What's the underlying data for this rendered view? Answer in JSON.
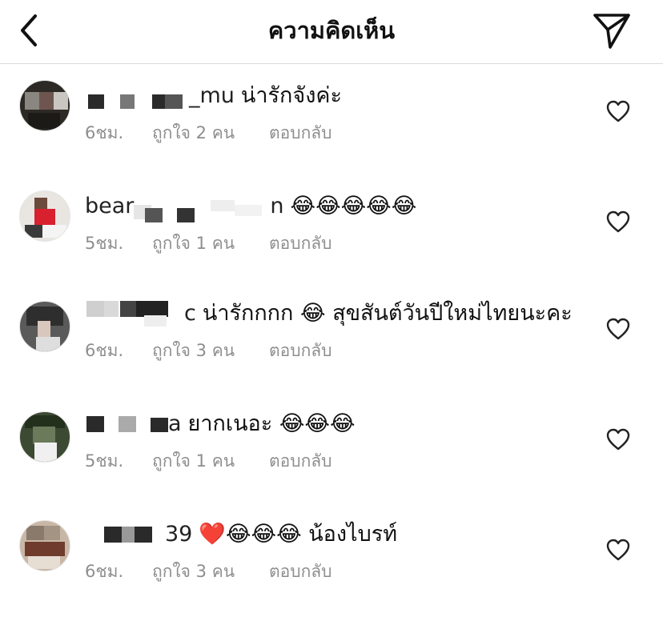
{
  "header": {
    "title": "ความคิดเห็น",
    "back_icon": "chevron-left-icon",
    "share_icon": "paper-plane-icon"
  },
  "comments": [
    {
      "username_visible": "_mu",
      "text": "น่ารักจังค่ะ",
      "time": "6ชม.",
      "likes": "ถูกใจ 2 คน",
      "reply": "ตอบกลับ"
    },
    {
      "username_visible": "bear",
      "username_visible_end": "n",
      "text": "😂😂😂😂😂",
      "time": "5ชม.",
      "likes": "ถูกใจ 1 คน",
      "reply": "ตอบกลับ"
    },
    {
      "username_visible": "c",
      "text": "น่ารักกกก 😂 สุขสันต์วันปีใหม่ไทยนะคะ",
      "time": "6ชม.",
      "likes": "ถูกใจ 3 คน",
      "reply": "ตอบกลับ"
    },
    {
      "username_visible": "a",
      "text": "ยากเนอะ 😂😂😂",
      "time": "5ชม.",
      "likes": "ถูกใจ 1 คน",
      "reply": "ตอบกลับ"
    },
    {
      "username_visible": "39",
      "text": "❤️😂😂😂 น้องไบรท์",
      "time": "6ชม.",
      "likes": "ถูกใจ 3 คน",
      "reply": "ตอบกลับ"
    }
  ],
  "colors": {
    "text": "#111111",
    "meta": "#8e8e8e",
    "divider": "#dbdbdb",
    "heart_red": "#e02020"
  }
}
